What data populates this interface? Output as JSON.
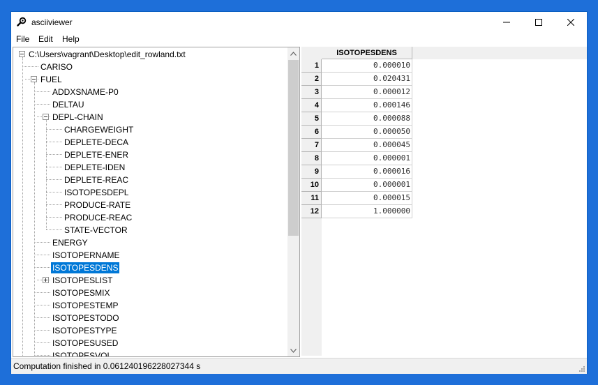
{
  "window": {
    "title": "asciiviewer",
    "minimize_glyph": "—",
    "maximize_glyph": "☐",
    "close_glyph": "✕"
  },
  "menu": [
    "File",
    "Edit",
    "Help"
  ],
  "tree": {
    "root": "C:\\Users\\vagrant\\Desktop\\edit_rowland.txt",
    "nodes": [
      {
        "label": "CARISO"
      },
      {
        "label": "FUEL"
      },
      {
        "label": "ADDXSNAME-P0"
      },
      {
        "label": "DELTAU"
      },
      {
        "label": "DEPL-CHAIN"
      },
      {
        "label": "CHARGEWEIGHT"
      },
      {
        "label": "DEPLETE-DECA"
      },
      {
        "label": "DEPLETE-ENER"
      },
      {
        "label": "DEPLETE-IDEN"
      },
      {
        "label": "DEPLETE-REAC"
      },
      {
        "label": "ISOTOPESDEPL"
      },
      {
        "label": "PRODUCE-RATE"
      },
      {
        "label": "PRODUCE-REAC"
      },
      {
        "label": "STATE-VECTOR"
      },
      {
        "label": "ENERGY"
      },
      {
        "label": "ISOTOPERNAME"
      },
      {
        "label": "ISOTOPESDENS",
        "selected": true
      },
      {
        "label": "ISOTOPESLIST"
      },
      {
        "label": "ISOTOPESMIX"
      },
      {
        "label": "ISOTOPESTEMP"
      },
      {
        "label": "ISOTOPESTODO"
      },
      {
        "label": "ISOTOPESTYPE"
      },
      {
        "label": "ISOTOPESUSED"
      },
      {
        "label": "ISOTOPESVOL"
      }
    ]
  },
  "grid": {
    "column_header": "ISOTOPESDENS",
    "rows": [
      {
        "index": "1",
        "value": "0.000010"
      },
      {
        "index": "2",
        "value": "0.020431"
      },
      {
        "index": "3",
        "value": "0.000012"
      },
      {
        "index": "4",
        "value": "0.000146"
      },
      {
        "index": "5",
        "value": "0.000088"
      },
      {
        "index": "6",
        "value": "0.000050"
      },
      {
        "index": "7",
        "value": "0.000045"
      },
      {
        "index": "8",
        "value": "0.000001"
      },
      {
        "index": "9",
        "value": "0.000016"
      },
      {
        "index": "10",
        "value": "0.000001"
      },
      {
        "index": "11",
        "value": "0.000015"
      },
      {
        "index": "12",
        "value": "1.000000"
      }
    ]
  },
  "status": {
    "text": "Computation finished in 0.061240196228027344 s"
  },
  "colors": {
    "desktop": "#1e6fd9",
    "selection": "#0078d7"
  }
}
